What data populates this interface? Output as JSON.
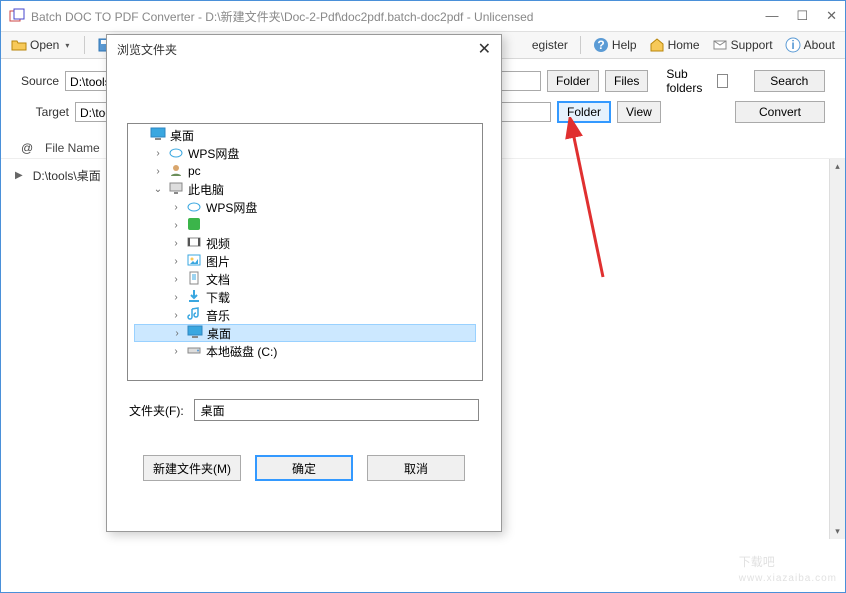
{
  "window": {
    "title": "Batch DOC TO PDF Converter - D:\\新建文件夹\\Doc-2-Pdf\\doc2pdf.batch-doc2pdf - Unlicensed"
  },
  "toolbar": {
    "open": "Open",
    "register": "egister",
    "help": "Help",
    "home": "Home",
    "support": "Support",
    "about": "About"
  },
  "form": {
    "source_label": "Source",
    "source_value": "D:\\tools\\桌",
    "target_label": "Target",
    "target_value": "D:\\tools\\桌",
    "folder_btn": "Folder",
    "files_btn": "Files",
    "subfolders_label": "Sub folders",
    "search_btn": "Search",
    "view_btn": "View",
    "convert_btn": "Convert"
  },
  "list": {
    "col_at": "@",
    "col_filename": "File Name",
    "row0_path": "D:\\tools\\桌面"
  },
  "dialog": {
    "title": "浏览文件夹",
    "folder_label": "文件夹(F):",
    "folder_value": "桌面",
    "new_folder_btn": "新建文件夹(M)",
    "ok_btn": "确定",
    "cancel_btn": "取消",
    "tree": {
      "n0": "桌面",
      "n1": "WPS网盘",
      "n2": "pc",
      "n3": "此电脑",
      "n4": "WPS网盘",
      "n5": "",
      "n6": "视频",
      "n7": "图片",
      "n8": "文档",
      "n9": "下载",
      "n10": "音乐",
      "n11": "桌面",
      "n12": "本地磁盘 (C:)"
    }
  },
  "watermark": {
    "text": "下载吧",
    "sub": "www.xiazaiba.com"
  }
}
